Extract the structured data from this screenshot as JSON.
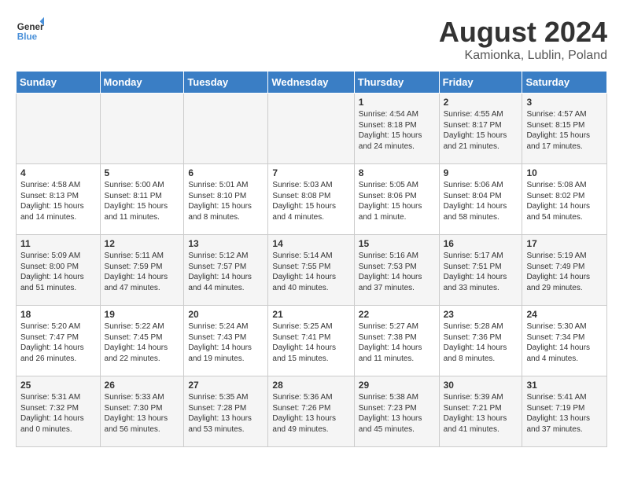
{
  "header": {
    "logo_line1": "General",
    "logo_line2": "Blue",
    "month_title": "August 2024",
    "location": "Kamionka, Lublin, Poland"
  },
  "days_of_week": [
    "Sunday",
    "Monday",
    "Tuesday",
    "Wednesday",
    "Thursday",
    "Friday",
    "Saturday"
  ],
  "weeks": [
    [
      {
        "day": "",
        "content": ""
      },
      {
        "day": "",
        "content": ""
      },
      {
        "day": "",
        "content": ""
      },
      {
        "day": "",
        "content": ""
      },
      {
        "day": "1",
        "content": "Sunrise: 4:54 AM\nSunset: 8:18 PM\nDaylight: 15 hours and 24 minutes."
      },
      {
        "day": "2",
        "content": "Sunrise: 4:55 AM\nSunset: 8:17 PM\nDaylight: 15 hours and 21 minutes."
      },
      {
        "day": "3",
        "content": "Sunrise: 4:57 AM\nSunset: 8:15 PM\nDaylight: 15 hours and 17 minutes."
      }
    ],
    [
      {
        "day": "4",
        "content": "Sunrise: 4:58 AM\nSunset: 8:13 PM\nDaylight: 15 hours and 14 minutes."
      },
      {
        "day": "5",
        "content": "Sunrise: 5:00 AM\nSunset: 8:11 PM\nDaylight: 15 hours and 11 minutes."
      },
      {
        "day": "6",
        "content": "Sunrise: 5:01 AM\nSunset: 8:10 PM\nDaylight: 15 hours and 8 minutes."
      },
      {
        "day": "7",
        "content": "Sunrise: 5:03 AM\nSunset: 8:08 PM\nDaylight: 15 hours and 4 minutes."
      },
      {
        "day": "8",
        "content": "Sunrise: 5:05 AM\nSunset: 8:06 PM\nDaylight: 15 hours and 1 minute."
      },
      {
        "day": "9",
        "content": "Sunrise: 5:06 AM\nSunset: 8:04 PM\nDaylight: 14 hours and 58 minutes."
      },
      {
        "day": "10",
        "content": "Sunrise: 5:08 AM\nSunset: 8:02 PM\nDaylight: 14 hours and 54 minutes."
      }
    ],
    [
      {
        "day": "11",
        "content": "Sunrise: 5:09 AM\nSunset: 8:00 PM\nDaylight: 14 hours and 51 minutes."
      },
      {
        "day": "12",
        "content": "Sunrise: 5:11 AM\nSunset: 7:59 PM\nDaylight: 14 hours and 47 minutes."
      },
      {
        "day": "13",
        "content": "Sunrise: 5:12 AM\nSunset: 7:57 PM\nDaylight: 14 hours and 44 minutes."
      },
      {
        "day": "14",
        "content": "Sunrise: 5:14 AM\nSunset: 7:55 PM\nDaylight: 14 hours and 40 minutes."
      },
      {
        "day": "15",
        "content": "Sunrise: 5:16 AM\nSunset: 7:53 PM\nDaylight: 14 hours and 37 minutes."
      },
      {
        "day": "16",
        "content": "Sunrise: 5:17 AM\nSunset: 7:51 PM\nDaylight: 14 hours and 33 minutes."
      },
      {
        "day": "17",
        "content": "Sunrise: 5:19 AM\nSunset: 7:49 PM\nDaylight: 14 hours and 29 minutes."
      }
    ],
    [
      {
        "day": "18",
        "content": "Sunrise: 5:20 AM\nSunset: 7:47 PM\nDaylight: 14 hours and 26 minutes."
      },
      {
        "day": "19",
        "content": "Sunrise: 5:22 AM\nSunset: 7:45 PM\nDaylight: 14 hours and 22 minutes."
      },
      {
        "day": "20",
        "content": "Sunrise: 5:24 AM\nSunset: 7:43 PM\nDaylight: 14 hours and 19 minutes."
      },
      {
        "day": "21",
        "content": "Sunrise: 5:25 AM\nSunset: 7:41 PM\nDaylight: 14 hours and 15 minutes."
      },
      {
        "day": "22",
        "content": "Sunrise: 5:27 AM\nSunset: 7:38 PM\nDaylight: 14 hours and 11 minutes."
      },
      {
        "day": "23",
        "content": "Sunrise: 5:28 AM\nSunset: 7:36 PM\nDaylight: 14 hours and 8 minutes."
      },
      {
        "day": "24",
        "content": "Sunrise: 5:30 AM\nSunset: 7:34 PM\nDaylight: 14 hours and 4 minutes."
      }
    ],
    [
      {
        "day": "25",
        "content": "Sunrise: 5:31 AM\nSunset: 7:32 PM\nDaylight: 14 hours and 0 minutes."
      },
      {
        "day": "26",
        "content": "Sunrise: 5:33 AM\nSunset: 7:30 PM\nDaylight: 13 hours and 56 minutes."
      },
      {
        "day": "27",
        "content": "Sunrise: 5:35 AM\nSunset: 7:28 PM\nDaylight: 13 hours and 53 minutes."
      },
      {
        "day": "28",
        "content": "Sunrise: 5:36 AM\nSunset: 7:26 PM\nDaylight: 13 hours and 49 minutes."
      },
      {
        "day": "29",
        "content": "Sunrise: 5:38 AM\nSunset: 7:23 PM\nDaylight: 13 hours and 45 minutes."
      },
      {
        "day": "30",
        "content": "Sunrise: 5:39 AM\nSunset: 7:21 PM\nDaylight: 13 hours and 41 minutes."
      },
      {
        "day": "31",
        "content": "Sunrise: 5:41 AM\nSunset: 7:19 PM\nDaylight: 13 hours and 37 minutes."
      }
    ]
  ]
}
